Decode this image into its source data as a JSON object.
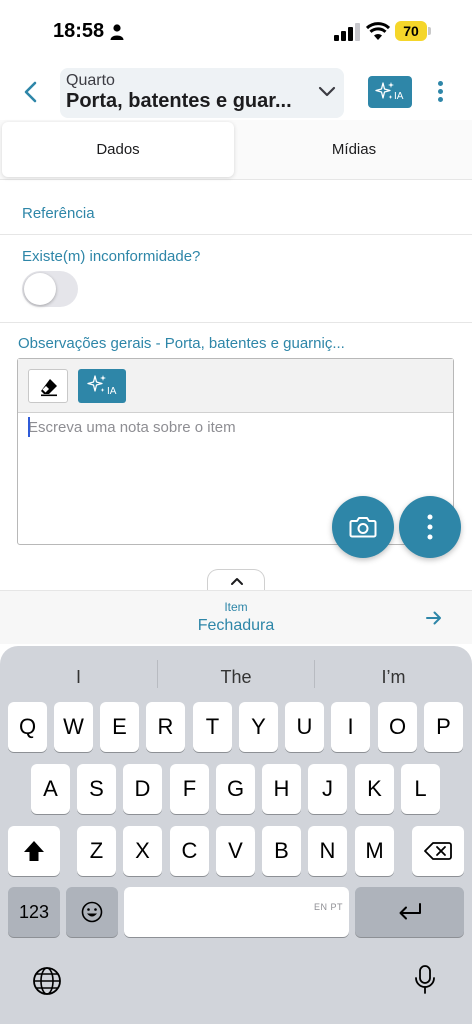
{
  "status_bar": {
    "time": "18:58",
    "battery": "70"
  },
  "header": {
    "label": "Quarto",
    "value": "Porta, batentes e guar...",
    "ai_badge": "IA"
  },
  "tabs": [
    {
      "label": "Dados"
    },
    {
      "label": "Mídias"
    }
  ],
  "form": {
    "reference_label": "Referência",
    "nonconformity_label": "Existe(m) inconformidade?",
    "nonconformity_value": false,
    "observations_label": "Observações gerais - Porta, batentes e guarniç...",
    "editor_ai_badge": "IA",
    "editor_placeholder": "Escreva uma nota sobre o item"
  },
  "next_item": {
    "caption": "Item",
    "value": "Fechadura"
  },
  "keyboard": {
    "suggestions": [
      "I",
      "The",
      "I’m"
    ],
    "row1": [
      "Q",
      "W",
      "E",
      "R",
      "T",
      "Y",
      "U",
      "I",
      "O",
      "P"
    ],
    "row2": [
      "A",
      "S",
      "D",
      "F",
      "G",
      "H",
      "J",
      "K",
      "L"
    ],
    "row3": [
      "Z",
      "X",
      "C",
      "V",
      "B",
      "N",
      "M"
    ],
    "numbers_key": "123",
    "space_lang": "EN PT"
  },
  "colors": {
    "accent": "#2e86a8",
    "battery": "#f5d62a",
    "keyboard_bg": "#d1d4da"
  }
}
